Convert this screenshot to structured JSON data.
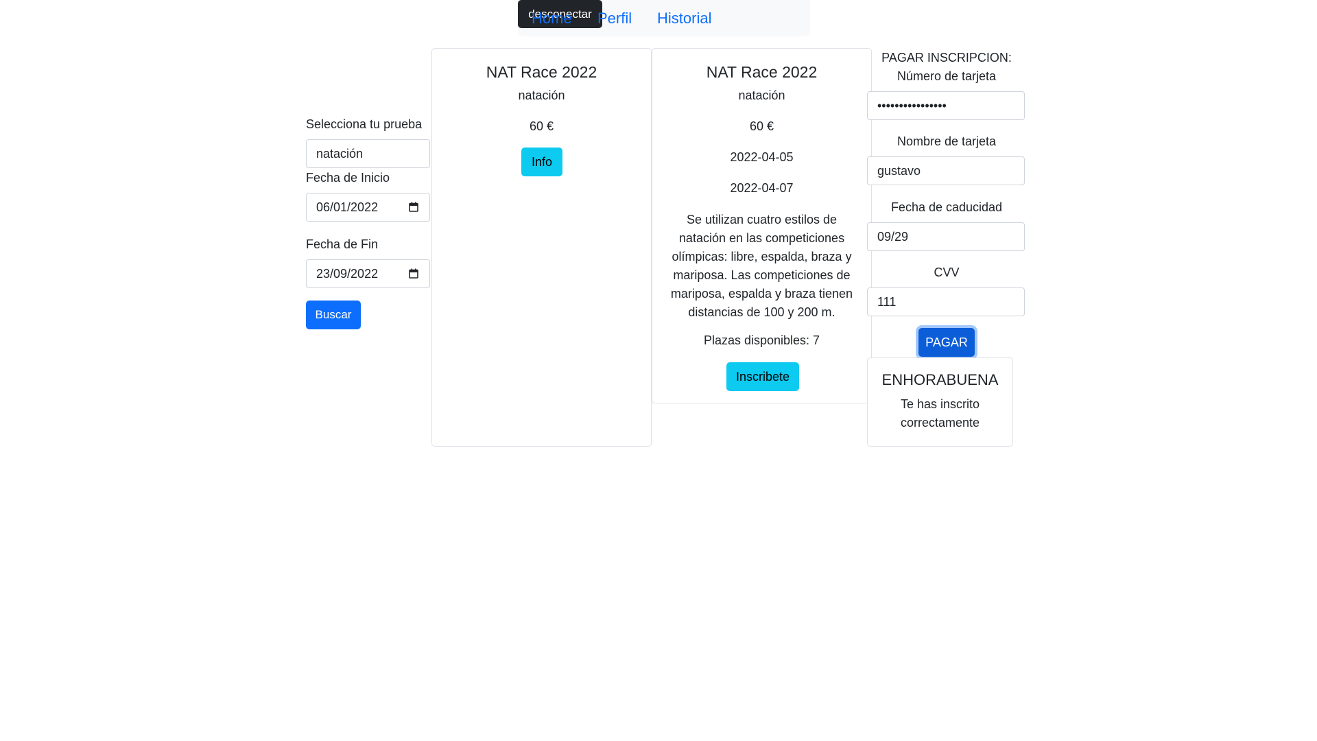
{
  "nav": {
    "home": "Home",
    "perfil": "Perfil",
    "historial": "Historial",
    "desconectar": "desconectar"
  },
  "search": {
    "prueba_label": "Selecciona tu prueba",
    "prueba_value": "natación",
    "inicio_label": "Fecha de Inicio",
    "inicio_value": "06/01/2022",
    "fin_label": "Fecha de Fin",
    "fin_value": "23/09/2022",
    "buscar": "Buscar"
  },
  "card1": {
    "title": "NAT Race 2022",
    "sport": "natación",
    "price": "60 €",
    "info_button": "Info"
  },
  "card2": {
    "title": "NAT Race 2022",
    "sport": "natación",
    "price": "60 €",
    "start_date": "2022-04-05",
    "end_date": "2022-04-07",
    "description": [
      "Se utilizan cuatro estilos de",
      "natación en las competiciones",
      "olímpicas: libre, espalda, braza y",
      "mariposa. Las competiciones de",
      "mariposa, espalda y braza tienen",
      "distancias de 100 y 200 m."
    ],
    "plazas": "Plazas disponibles: 7",
    "inscribete_button": "Inscribete"
  },
  "payment": {
    "heading": "PAGAR INSCRIPCION:",
    "numero_label": "Número de tarjeta",
    "numero_value": "••••••••••••••••",
    "nombre_label": "Nombre de tarjeta",
    "nombre_value": "gustavo",
    "caducidad_label": "Fecha de caducidad",
    "caducidad_value": "09/29",
    "cvv_label": "CVV",
    "cvv_value": "111",
    "pagar_button": "PAGAR"
  },
  "success": {
    "title": "ENHORABUENA",
    "line1": "Te has inscrito",
    "line2": "correctamente"
  },
  "colors": {
    "primary": "#0d6efd",
    "info": "#0dcaf0",
    "dark": "#212529",
    "link": "#0d6efd"
  }
}
